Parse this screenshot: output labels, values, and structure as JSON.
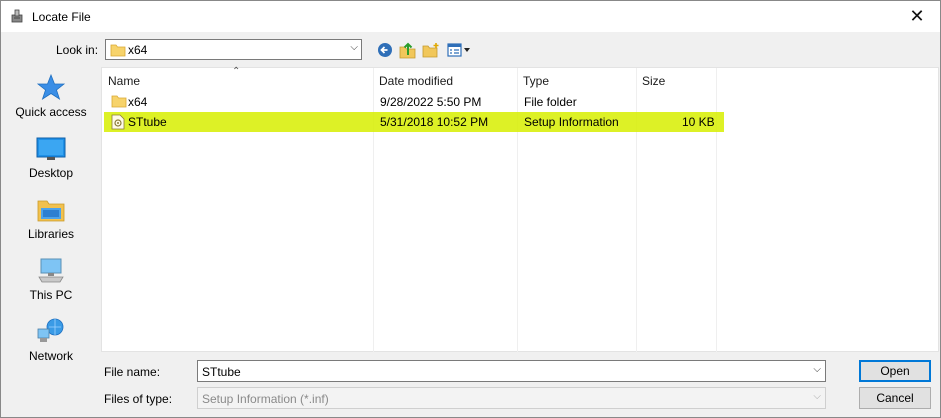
{
  "window": {
    "title": "Locate File",
    "close_glyph": "✕"
  },
  "toolbar": {
    "look_in_label": "Look in:",
    "look_in_value": "x64",
    "icons": [
      "back-icon",
      "up-folder-icon",
      "new-folder-icon",
      "view-menu-icon"
    ]
  },
  "places": [
    {
      "label": "Quick access",
      "icon": "quick-access-star-icon"
    },
    {
      "label": "Desktop",
      "icon": "desktop-icon"
    },
    {
      "label": "Libraries",
      "icon": "libraries-icon"
    },
    {
      "label": "This PC",
      "icon": "this-pc-icon"
    },
    {
      "label": "Network",
      "icon": "network-icon"
    }
  ],
  "columns": {
    "name": "Name",
    "date": "Date modified",
    "type": "Type",
    "size": "Size"
  },
  "files": [
    {
      "name": "x64",
      "date": "9/28/2022 5:50 PM",
      "type": "File folder",
      "size": "",
      "icon": "folder-icon"
    },
    {
      "name": "STtube",
      "date": "5/31/2018 10:52 PM",
      "type": "Setup Information",
      "size": "10 KB",
      "icon": "setup-information-file-icon",
      "highlighted": true
    }
  ],
  "footer": {
    "file_name_label": "File name:",
    "file_name_value": "STtube",
    "file_type_label": "Files of type:",
    "file_type_value": "Setup Information (*.inf)",
    "open_label": "Open",
    "cancel_label": "Cancel"
  },
  "colors": {
    "highlight": "#d7ee00",
    "accent": "#0078d7"
  }
}
